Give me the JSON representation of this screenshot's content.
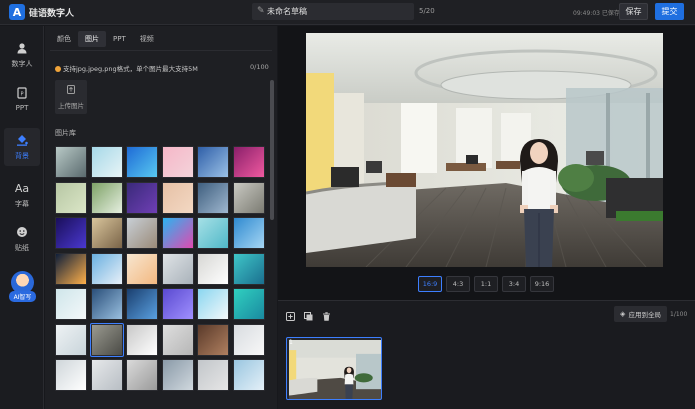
{
  "header": {
    "brand": "硅语数字人",
    "draft_title": "未命名草稿",
    "title_count": "5/20",
    "saved_status": "09:49:03 已保存",
    "save_label": "保存",
    "submit_label": "提交"
  },
  "nav": {
    "items": [
      {
        "label": "数字人",
        "icon": "avatar-icon"
      },
      {
        "label": "PPT",
        "icon": "ppt-icon"
      },
      {
        "label": "背景",
        "icon": "paint-bucket-icon"
      },
      {
        "label": "字幕",
        "icon": "text-icon"
      },
      {
        "label": "贴纸",
        "icon": "sticker-icon"
      }
    ],
    "ai_label": "AI智写"
  },
  "panel": {
    "tabs": [
      "颜色",
      "图片",
      "PPT",
      "视频"
    ],
    "active_tab": "图片",
    "hint": "支持jpg,jpeg,png格式，单个图片最大支持5M",
    "count": "0/100",
    "upload_label": "上传图片",
    "library_title": "图片库"
  },
  "thumbnails": [
    [
      "#b8c9c6",
      "#5a6a6e"
    ],
    [
      "#a6d8e8",
      "#e8f4f6"
    ],
    [
      "#1e6bd6",
      "#58c8f0"
    ],
    [
      "#f6b7c8",
      "#f3d3da"
    ],
    [
      "#2f5fa8",
      "#9bc1e6"
    ],
    [
      "#8a1f6a",
      "#f05aa0"
    ],
    [
      "#b7c7a4",
      "#dbe6c7"
    ],
    [
      "#7ea267",
      "#e6efe0"
    ],
    [
      "#3a2a7a",
      "#6f3fb5"
    ],
    [
      "#e6c1a6",
      "#f3d8c3"
    ],
    [
      "#3f5f7f",
      "#9fb7cf"
    ],
    [
      "#c9c9c2",
      "#7b7b72"
    ],
    [
      "#1a0f5a",
      "#4a38d0"
    ],
    [
      "#d9c59c",
      "#7a6448"
    ],
    [
      "#c8cfd6",
      "#9a8a78"
    ],
    [
      "#2bb4f0",
      "#e04ab0"
    ],
    [
      "#a6e0e6",
      "#50b8c8"
    ],
    [
      "#2f8ad0",
      "#a6d6f4"
    ],
    [
      "#0f1f3a",
      "#ffb04a"
    ],
    [
      "#6ab0e0",
      "#e8f0f8"
    ],
    [
      "#f7e6d0",
      "#f3b880"
    ],
    [
      "#dfe3e6",
      "#a9b2ba"
    ],
    [
      "#d7d7d4",
      "#ffffff"
    ],
    [
      "#3fc6c8",
      "#1a6f8f"
    ],
    [
      "#cfe6ea",
      "#f4f8fa"
    ],
    [
      "#2a4f7a",
      "#9ac0e0"
    ],
    [
      "#1a3f6f",
      "#5aa0e0"
    ],
    [
      "#5a4ad0",
      "#a090ff"
    ],
    [
      "#8ad6f0",
      "#f4f8fa"
    ],
    [
      "#30d0c0",
      "#1a8aa0"
    ],
    [
      "#eef2f4",
      "#c8d4da"
    ],
    [
      "#9a9a90",
      "#4a4a45"
    ],
    [
      "#c8c8c8",
      "#ffffff"
    ],
    [
      "#dedede",
      "#b6b6b6"
    ],
    [
      "#5a3a2a",
      "#b08060"
    ],
    [
      "#d8dce0",
      "#f8f8f8"
    ],
    [
      "#cfd6da",
      "#ffffff"
    ],
    [
      "#e6e8ea",
      "#b8bec4"
    ],
    [
      "#dadada",
      "#9a9a9a"
    ],
    [
      "#8a9aa8",
      "#d0d8de"
    ],
    [
      "#c2c6ca",
      "#e6e6e6"
    ],
    [
      "#9ac6e0",
      "#e4f0f8"
    ]
  ],
  "preview": {
    "ratios": [
      "16:9",
      "4:3",
      "1:1",
      "3:4",
      "9:16"
    ],
    "active_ratio": "16:9"
  },
  "timeline": {
    "apply_label": "应用到全局",
    "page_count": "1/100",
    "scene_number": "1"
  },
  "colors": {
    "accent": "#1f6fe0",
    "active_text": "#3d7fff",
    "hint_dot": "#f0a43a"
  }
}
